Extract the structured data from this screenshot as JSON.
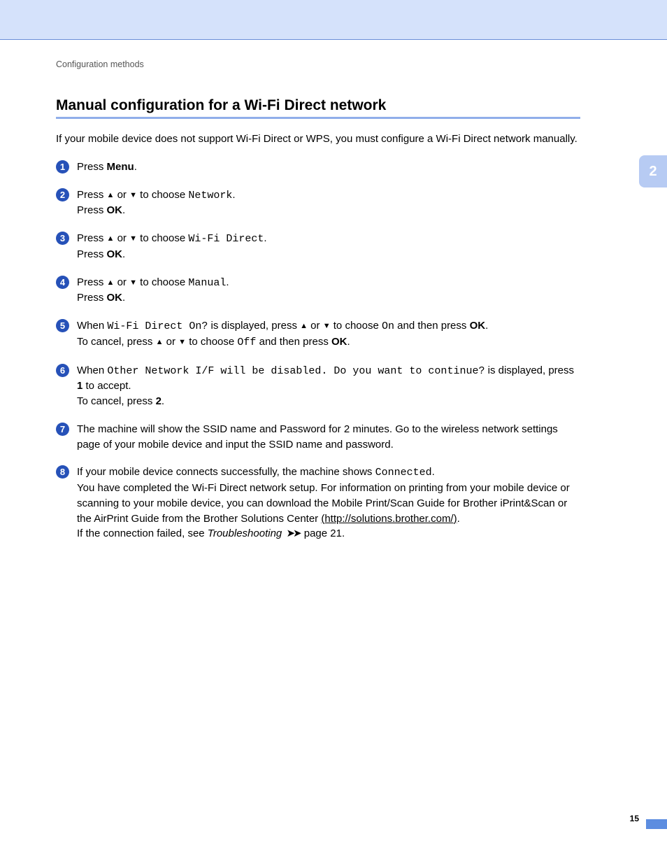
{
  "header": {
    "breadcrumb": "Configuration methods",
    "chapter_tab": "2"
  },
  "main": {
    "heading": "Manual configuration for a Wi-Fi Direct network",
    "intro": "If your mobile device does not support Wi-Fi Direct or WPS, you must configure a Wi-Fi Direct network manually.",
    "steps": {
      "s1": {
        "t1": "Press ",
        "b1": "Menu",
        "t2": "."
      },
      "s2": {
        "t1": "Press ",
        "t2": " or ",
        "t3": " to choose ",
        "m1": "Network",
        "t4": ".",
        "l2": "Press ",
        "b1": "OK",
        "t5": "."
      },
      "s3": {
        "t1": "Press ",
        "t2": " or ",
        "t3": " to choose ",
        "m1": "Wi-Fi Direct",
        "t4": ".",
        "l2": "Press ",
        "b1": "OK",
        "t5": "."
      },
      "s4": {
        "t1": "Press ",
        "t2": " or ",
        "t3": " to choose ",
        "m1": "Manual",
        "t4": ".",
        "l2": "Press ",
        "b1": "OK",
        "t5": "."
      },
      "s5": {
        "t1": "When ",
        "m1": "Wi-Fi Direct On?",
        "t2": " is displayed, press ",
        "t3": " or ",
        "t4": " to choose ",
        "m2": "On",
        "t5": " and then press ",
        "b1": "OK",
        "t6": ".",
        "l2a": "To cancel, press ",
        "l2b": " or ",
        "l2c": " to choose ",
        "m3": "Off",
        "l2d": " and then press ",
        "b2": "OK",
        "l2e": "."
      },
      "s6": {
        "t1": "When ",
        "m1": "Other Network I/F will be disabled. Do you want to continue?",
        "t2": " is displayed, press ",
        "b1": "1",
        "t3": " to accept.",
        "l2": "To cancel, press ",
        "b2": "2",
        "t4": "."
      },
      "s7": {
        "t1": "The machine will show the SSID name and Password for 2 minutes. Go to the wireless network settings page of your mobile device and input the SSID name and password."
      },
      "s8": {
        "t1": "If your mobile device connects successfully, the machine shows ",
        "m1": "Connected",
        "t2": ".",
        "t3": "You have completed the Wi-Fi Direct network setup. For information on printing from your mobile device or scanning to your mobile device, you can download the Mobile Print/Scan Guide for Brother iPrint&Scan or the AirPrint Guide from the Brother Solutions Center ",
        "link": "(http://solutions.brother.com/)",
        "t4": ".",
        "t5": "If the connection failed, see ",
        "i1": "Troubleshooting",
        "t6": " page 21."
      }
    }
  },
  "footer": {
    "page": "15"
  },
  "glyphs": {
    "up": "▲",
    "down": "▼",
    "arrows": "➤➤"
  }
}
